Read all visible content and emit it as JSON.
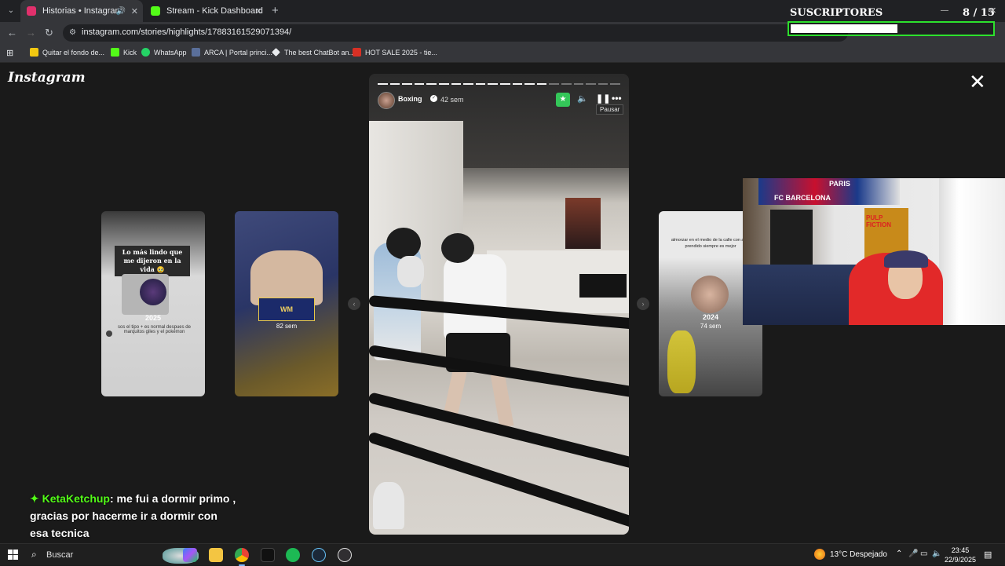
{
  "browser": {
    "tabs": [
      {
        "title": "Historias • Instagram",
        "active": true,
        "favicon_color": "#e1306c"
      },
      {
        "title": "Stream - Kick Dashboard",
        "active": false,
        "favicon_color": "#53fc18"
      }
    ],
    "url": "instagram.com/stories/highlights/17883161529071394/",
    "bookmarks": [
      {
        "label": "Quitar el fondo de...",
        "icon_color": "#f2c811"
      },
      {
        "label": "Kick",
        "icon_color": "#53fc18"
      },
      {
        "label": "WhatsApp",
        "icon_color": "#25d366"
      },
      {
        "label": "ARCA | Portal princi...",
        "icon_color": "#5a6f9a"
      },
      {
        "label": "The best ChatBot an...",
        "icon_color": "#e8eaed"
      },
      {
        "label": "HOT SALE 2025 - tie...",
        "icon_color": "#d93025"
      }
    ]
  },
  "subscribers": {
    "title": "SUSCRIPTORES",
    "current": "8",
    "goal": "15",
    "progress": 0.53
  },
  "instagram": {
    "logo": "Instagram",
    "story": {
      "username": "Boxing",
      "age": "42 sem",
      "pause_tooltip": "Pausar",
      "segments_total": 20,
      "segments_done": 14
    },
    "side_stories": [
      {
        "caption": "Lo más lindo que me dijeron en la vida 🥹",
        "year": "2025",
        "subtext": "sos el tipo + es normal despues de marquitos giles y el pokémon"
      },
      {
        "caption": "",
        "year": "",
        "age": "82 sem"
      },
      {
        "caption": "almorzar en el medio de la calle con auto prendido siempre es mejor",
        "year": "2024",
        "age": "74 sem"
      }
    ]
  },
  "webcam": {
    "labels": {
      "club": "FC BARCELONA",
      "city": "PARIS",
      "poster": "PULP FICTION"
    }
  },
  "chat": {
    "user": "KetaKetchup",
    "message": ": me fui a dormir primo , gracias por hacerme ir a dormir con esa tecnica",
    "user_color": "#53fc18"
  },
  "taskbar": {
    "search_label": "Buscar",
    "apps": [
      {
        "name": "copilot",
        "color": "#3b82f6"
      },
      {
        "name": "file-explorer",
        "color": "#f4c542"
      },
      {
        "name": "chrome",
        "color": "#ea4335"
      },
      {
        "name": "tiktok",
        "color": "#111111"
      },
      {
        "name": "spotify",
        "color": "#1db954"
      },
      {
        "name": "steam",
        "color": "#1b2838"
      },
      {
        "name": "obs",
        "color": "#302e31"
      }
    ],
    "weather": "13°C  Despejado",
    "time": "23:45",
    "date": "22/9/2025"
  }
}
